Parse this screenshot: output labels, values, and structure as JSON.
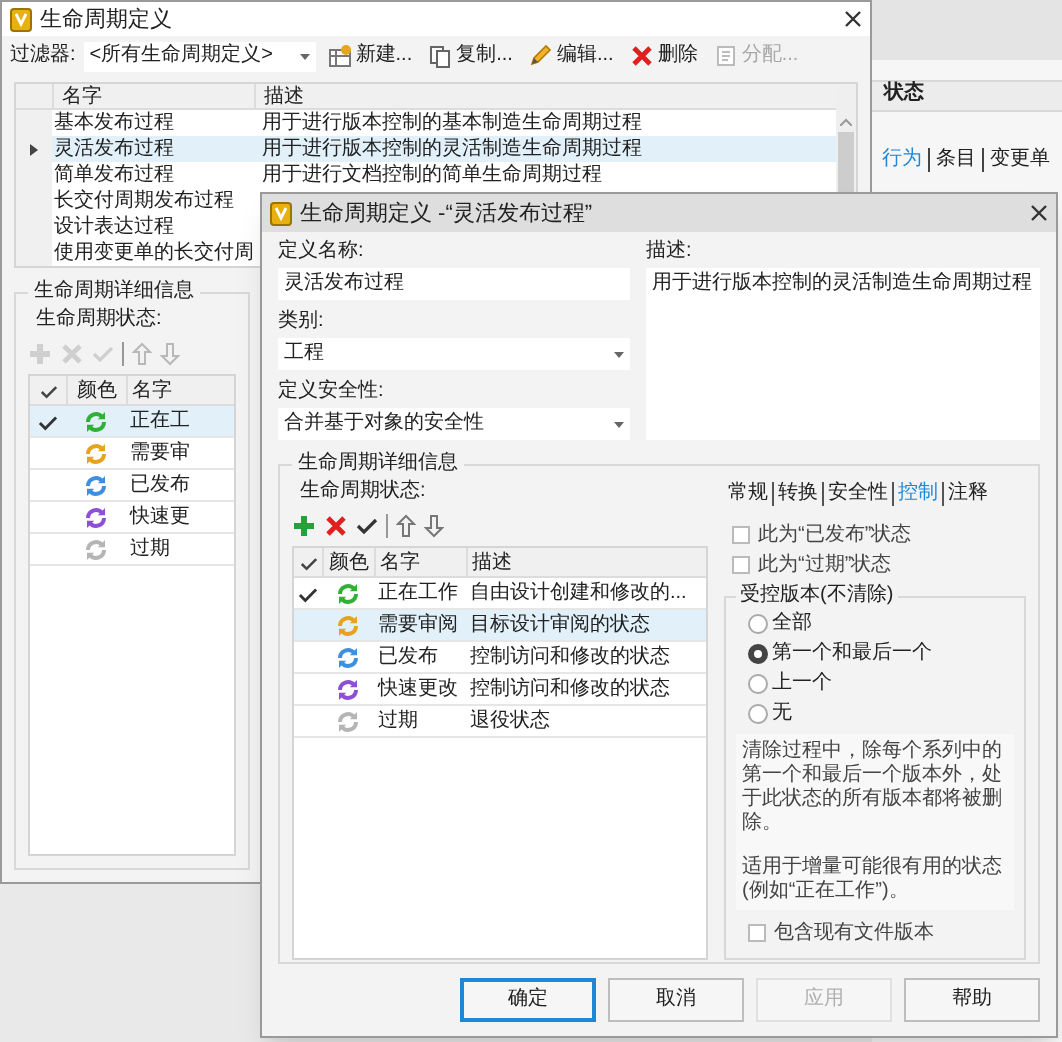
{
  "background_app": {
    "column_header": "状态",
    "tabs": [
      {
        "label": "行为",
        "selected": true
      },
      {
        "label": "条目",
        "selected": false
      },
      {
        "label": "变更单",
        "selected": false
      }
    ]
  },
  "main_window": {
    "title": "生命周期定义",
    "filter_label": "过滤器:",
    "filter_value": "<所有生命周期定义>",
    "toolbar": [
      {
        "label": "新建...",
        "kind": "new",
        "disabled": false
      },
      {
        "label": "复制...",
        "kind": "copy",
        "disabled": false
      },
      {
        "label": "编辑...",
        "kind": "edit",
        "disabled": false
      },
      {
        "label": "删除",
        "kind": "delete",
        "disabled": false
      },
      {
        "label": "分配...",
        "kind": "assign",
        "disabled": true
      }
    ],
    "table": {
      "columns": [
        "名字",
        "描述"
      ],
      "rows": [
        {
          "name": "基本发布过程",
          "description": "用于进行版本控制的基本制造生命周期过程",
          "selected": false
        },
        {
          "name": "灵活发布过程",
          "description": "用于进行版本控制的灵活制造生命周期过程",
          "selected": true
        },
        {
          "name": "简单发布过程",
          "description": "用于进行文档控制的简单生命周期过程",
          "selected": false
        },
        {
          "name": "长交付周期发布过程",
          "selected": false
        },
        {
          "name": "设计表达过程",
          "selected": false
        },
        {
          "name": "使用变更单的长交付周",
          "selected": false
        }
      ]
    },
    "details": {
      "title": "生命周期详细信息",
      "states_label": "生命周期状态:",
      "toolbar_disabled": true,
      "columns": [
        "颜色",
        "名字"
      ],
      "states": [
        {
          "name": "正在工",
          "color": "#2eb135",
          "checked": true,
          "selected": true
        },
        {
          "name": "需要审",
          "color": "#e8a31c",
          "checked": false,
          "selected": false
        },
        {
          "name": "已发布",
          "color": "#3d8fe0",
          "checked": false,
          "selected": false
        },
        {
          "name": "快速更",
          "color": "#8c4fd6",
          "checked": false,
          "selected": false
        },
        {
          "name": "过期",
          "color": "#b5b5b5",
          "checked": false,
          "selected": false
        }
      ]
    }
  },
  "dialog": {
    "title": "生命周期定义 -“灵活发布过程”",
    "name_label": "定义名称:",
    "name_value": "灵活发布过程",
    "category_label": "类别:",
    "category_value": "工程",
    "security_label": "定义安全性:",
    "security_value": "合并基于对象的安全性",
    "description_label": "描述:",
    "description_value": "用于进行版本控制的灵活制造生命周期过程",
    "details": {
      "title": "生命周期详细信息",
      "states_label": "生命周期状态:",
      "toolbar_disabled": false,
      "columns": [
        "颜色",
        "名字",
        "描述"
      ],
      "states": [
        {
          "name": "正在工作",
          "description": "自由设计创建和修改的...",
          "color": "#2eb135",
          "checked": true,
          "selected": false
        },
        {
          "name": "需要审阅",
          "description": "目标设计审阅的状态",
          "color": "#e8a31c",
          "checked": false,
          "selected": true
        },
        {
          "name": "已发布",
          "description": "控制访问和修改的状态",
          "color": "#3d8fe0",
          "checked": false,
          "selected": false
        },
        {
          "name": "快速更改",
          "description": "控制访问和修改的状态",
          "color": "#8c4fd6",
          "checked": false,
          "selected": false
        },
        {
          "name": "过期",
          "description": "退役状态",
          "color": "#b5b5b5",
          "checked": false,
          "selected": false
        }
      ]
    },
    "tabs": [
      {
        "label": "常规",
        "selected": false
      },
      {
        "label": "转换",
        "selected": false
      },
      {
        "label": "安全性",
        "selected": false
      },
      {
        "label": "控制",
        "selected": true
      },
      {
        "label": "注释",
        "selected": false
      }
    ],
    "checkboxes": [
      {
        "label": "此为“已发布”状态",
        "checked": false
      },
      {
        "label": "此为“过期”状态",
        "checked": false
      }
    ],
    "retention": {
      "title": "受控版本(不清除)",
      "options": [
        {
          "label": "全部",
          "selected": false
        },
        {
          "label": "第一个和最后一个",
          "selected": true
        },
        {
          "label": "上一个",
          "selected": false
        },
        {
          "label": "无",
          "selected": false
        }
      ],
      "help": [
        "清除过程中，除每个系列中的第一个和最后一个版本外，处于此状态的所有版本都将被删除。",
        "适用于增量可能很有用的状态(例如“正在工作”)。"
      ],
      "include_files": {
        "label": "包含现有文件版本",
        "checked": false
      }
    },
    "buttons": [
      {
        "label": "确定",
        "kind": "default",
        "disabled": false
      },
      {
        "label": "取消",
        "kind": "normal",
        "disabled": false
      },
      {
        "label": "应用",
        "kind": "normal",
        "disabled": true
      },
      {
        "label": "帮助",
        "kind": "normal",
        "disabled": false
      }
    ]
  }
}
